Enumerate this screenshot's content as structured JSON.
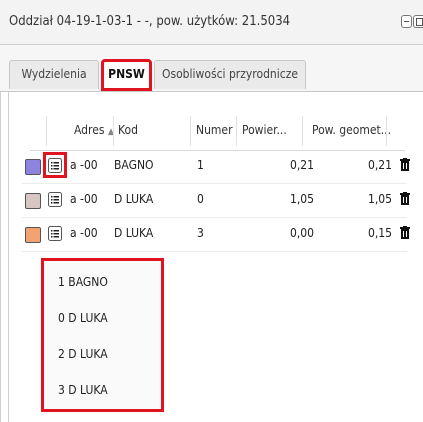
{
  "window": {
    "title": "Oddział 04-19-1-03-1 - -, pow. użytków: 21.5034"
  },
  "tabs": [
    {
      "label": "Wydzielenia"
    },
    {
      "label": "PNSW"
    },
    {
      "label": "Osobliwości przyrodnicze"
    }
  ],
  "table": {
    "headers": [
      "Adres",
      "Kod",
      "Numer",
      "Powier...",
      "Pow. geomet..."
    ],
    "sort_indicator": "▲",
    "rows": [
      {
        "color": "#8f83e0",
        "adres": "a -00",
        "kod": "BAGNO",
        "numer": "1",
        "powierzchnia": "0,21",
        "pow_geom": "0,21"
      },
      {
        "color": "#d6c7c4",
        "adres": "a -00",
        "kod": "D LUKA",
        "numer": "0",
        "powierzchnia": "1,05",
        "pow_geom": "1,05"
      },
      {
        "color": "#f5a273",
        "adres": "a -00",
        "kod": "D LUKA",
        "numer": "3",
        "powierzchnia": "0,00",
        "pow_geom": "0,15"
      }
    ]
  },
  "dropdown": {
    "items": [
      "1 BAGNO",
      "0 D LUKA",
      "2 D LUKA",
      "3 D LUKA"
    ]
  },
  "colors": {
    "highlight": "#e0141f"
  }
}
